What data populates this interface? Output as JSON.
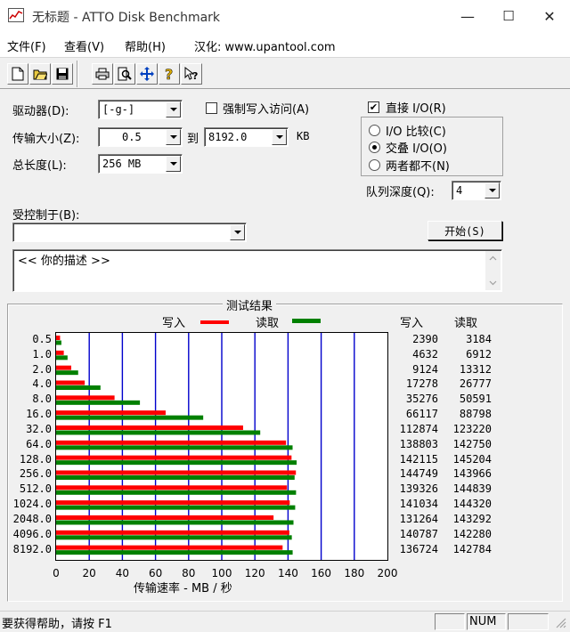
{
  "window": {
    "title": "无标题 - ATTO Disk Benchmark",
    "minimize": "—",
    "maximize": "☐",
    "close": "✕"
  },
  "menu": {
    "items": [
      "文件(F)",
      "查看(V)",
      "帮助(H)"
    ],
    "credit": "汉化: www.upantool.com"
  },
  "toolbar": {
    "icons": [
      "new-icon",
      "open-icon",
      "save-icon",
      "print-icon",
      "print-preview-icon",
      "move-icon",
      "help-icon",
      "context-help-icon"
    ]
  },
  "form": {
    "drive_label": "驱动器(D):",
    "drive_value": "[-g-]",
    "force_write_label": "强制写入访问(A)",
    "force_write_checked": false,
    "transfer_label": "传输大小(Z):",
    "transfer_from": "0.5",
    "to_label": "到",
    "transfer_to": "8192.0",
    "unit_kb": "KB",
    "total_label": "总长度(L):",
    "total_value": "256 MB",
    "direct_io_label": "直接 I/O(R)",
    "direct_io_checked": true,
    "radio_compare": "I/O 比较(C)",
    "radio_overlap": "交叠 I/O(O)",
    "radio_neither": "两者都不(N)",
    "radio_selected": "overlap",
    "queue_label": "队列深度(Q):",
    "queue_value": "4",
    "controlled_label": "受控制于(B):",
    "controlled_value": "",
    "start_button": "开始(S)",
    "description": "<<  你的描述   >>"
  },
  "results": {
    "title": "测试结果",
    "legend_write": "写入",
    "legend_read": "读取",
    "col_write": "写入",
    "col_read": "读取",
    "xlabel": "传输速率 - MB / 秒",
    "write_color": "#ff0000",
    "read_color": "#008000"
  },
  "chart_data": {
    "type": "bar",
    "orientation": "horizontal",
    "categories": [
      "0.5",
      "1.0",
      "2.0",
      "4.0",
      "8.0",
      "16.0",
      "32.0",
      "64.0",
      "128.0",
      "256.0",
      "512.0",
      "1024.0",
      "2048.0",
      "4096.0",
      "8192.0"
    ],
    "series": [
      {
        "name": "写入",
        "values": [
          2390,
          4632,
          9124,
          17278,
          35276,
          66117,
          112874,
          138803,
          142115,
          144749,
          139326,
          141034,
          131264,
          140787,
          136724
        ]
      },
      {
        "name": "读取",
        "values": [
          3184,
          6912,
          13312,
          26777,
          50591,
          88798,
          123220,
          142750,
          145204,
          143966,
          144839,
          144320,
          143292,
          142280,
          142784
        ]
      }
    ],
    "xticks": [
      "0",
      "20",
      "40",
      "60",
      "80",
      "100",
      "120",
      "140",
      "160",
      "180",
      "200"
    ],
    "xlim": [
      0,
      200
    ],
    "xlabel": "传输速率 - MB / 秒",
    "grid": true
  },
  "status": {
    "text": "要获得帮助，请按 F1",
    "num": "NUM"
  }
}
